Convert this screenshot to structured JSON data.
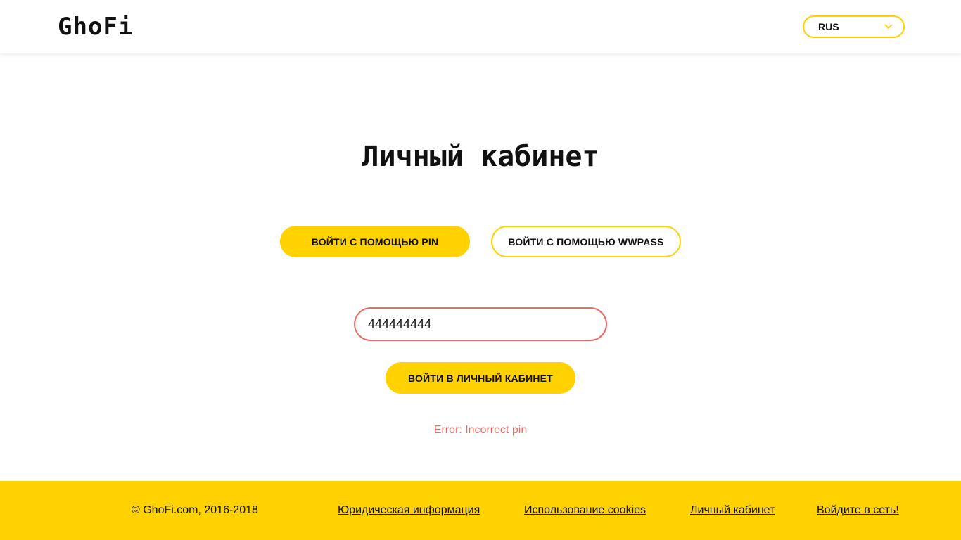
{
  "header": {
    "logo": "GhoFi",
    "language": "RUS"
  },
  "main": {
    "title": "Личный кабинет",
    "pin_button": "ВОЙТИ С ПОМОЩЬЮ PIN",
    "wwpass_button": "ВОЙТИ С ПОМОЩЬЮ WWPASS",
    "pin_value": "444444444",
    "login_button": "ВОЙТИ В ЛИЧНЫЙ КАБИНЕТ",
    "error": "Error: Incorrect pin"
  },
  "footer": {
    "copyright": "© GhoFi.com, 2016-2018",
    "links": [
      "Юридическая информация",
      "Использование cookies",
      "Личный кабинет",
      "Войдите в сеть!"
    ]
  },
  "colors": {
    "accent": "#FFD200",
    "error": "#EA6B66"
  }
}
